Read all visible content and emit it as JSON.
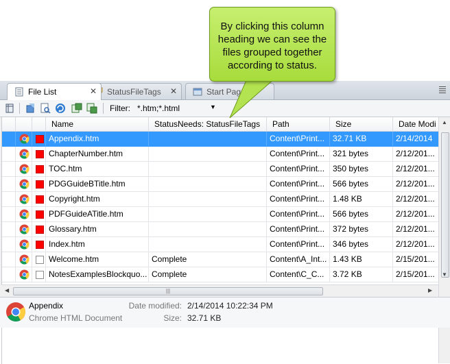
{
  "callout": {
    "text": "By clicking this column heading we can see the files grouped together according to status."
  },
  "tabs": [
    {
      "label": "File List",
      "active": true,
      "icon": "file-list-icon"
    },
    {
      "label": "StatusFileTags",
      "active": false,
      "icon": "tag-icon"
    },
    {
      "label": "Start Page",
      "active": false,
      "icon": "start-page-icon"
    }
  ],
  "toolbar": {
    "filter_label": "Filter:",
    "filter_value": "*.htm;*.html"
  },
  "columns": [
    "Name",
    "StatusNeeds: StatusFileTags",
    "Path",
    "Size",
    "Date Modi"
  ],
  "rows": [
    {
      "name": "Appendix.htm",
      "status": "",
      "path": "Content\\Print...",
      "size": "32.71 KB",
      "date": "2/14/2014",
      "flag": "red"
    },
    {
      "name": "ChapterNumber.htm",
      "status": "",
      "path": "Content\\Print...",
      "size": "321 bytes",
      "date": "2/12/201...",
      "flag": "red"
    },
    {
      "name": "TOC.htm",
      "status": "",
      "path": "Content\\Print...",
      "size": "350 bytes",
      "date": "2/12/201...",
      "flag": "red"
    },
    {
      "name": "PDGGuideBTitle.htm",
      "status": "",
      "path": "Content\\Print...",
      "size": "566 bytes",
      "date": "2/12/201...",
      "flag": "red"
    },
    {
      "name": "Copyright.htm",
      "status": "",
      "path": "Content\\Print...",
      "size": "1.48 KB",
      "date": "2/12/201...",
      "flag": "red"
    },
    {
      "name": "PDFGuideATitle.htm",
      "status": "",
      "path": "Content\\Print...",
      "size": "566 bytes",
      "date": "2/12/201...",
      "flag": "red"
    },
    {
      "name": "Glossary.htm",
      "status": "",
      "path": "Content\\Print...",
      "size": "372 bytes",
      "date": "2/12/201...",
      "flag": "red"
    },
    {
      "name": "Index.htm",
      "status": "",
      "path": "Content\\Print...",
      "size": "346 bytes",
      "date": "2/12/201...",
      "flag": "red"
    },
    {
      "name": "Welcome.htm",
      "status": "Complete",
      "path": "Content\\A_Int...",
      "size": "1.43 KB",
      "date": "2/15/201...",
      "flag": "none"
    },
    {
      "name": "NotesExamplesBlockquo...",
      "status": "Complete",
      "path": "Content\\C_C...",
      "size": "3.72 KB",
      "date": "2/15/201...",
      "flag": "none"
    }
  ],
  "details": {
    "name": "Appendix",
    "type": "Chrome HTML Document",
    "date_label": "Date modified:",
    "date_value": "2/14/2014 10:22:34 PM",
    "size_label": "Size:",
    "size_value": "32.71 KB"
  },
  "colors": {
    "selection": "#3399ff",
    "status_red": "#ff0000",
    "callout": "#b5e655"
  }
}
